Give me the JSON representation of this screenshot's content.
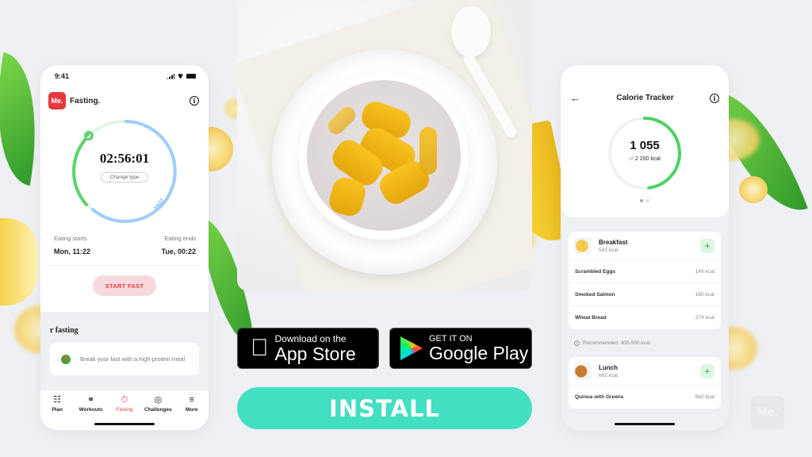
{
  "left_phone": {
    "status_time": "9:41",
    "logo_text": "Me.",
    "app_name": "Fasting.",
    "timer": "02:56:01",
    "change_type_label": "Change type",
    "ring_label": "FAST",
    "fast_progress": 0.4,
    "eating_starts_label": "Eating starts",
    "eating_starts_value": "Mon, 11:22",
    "eating_ends_label": "Eating ends",
    "eating_ends_value": "Tue, 00:22",
    "start_fast_label": "START FAST",
    "section_title": "r fasting",
    "tip_text": "Break your fast with a high-protein meal",
    "tabs": [
      {
        "label": "Plan",
        "icon": "plan-icon",
        "glyph": "☷"
      },
      {
        "label": "Workouts",
        "icon": "dumbbell-icon",
        "glyph": "⚭"
      },
      {
        "label": "Fasting",
        "icon": "stopwatch-icon",
        "glyph": "⏱",
        "active": true
      },
      {
        "label": "Challenges",
        "icon": "target-icon",
        "glyph": "◎"
      },
      {
        "label": "More",
        "icon": "menu-icon",
        "glyph": "≡"
      }
    ]
  },
  "right_phone": {
    "title": "Calorie Tracker",
    "calories_consumed": "1 055",
    "calories_of": "of",
    "calories_goal": "2 200 kcal",
    "progress": 0.48,
    "meals": [
      {
        "name": "Breakfast",
        "kcal": "583 kcal",
        "items": [
          {
            "name": "Scrambled Eggs",
            "kcal": "149 kcal"
          },
          {
            "name": "Smoked Salmon",
            "kcal": "160 kcal"
          },
          {
            "name": "Wheat Bread",
            "kcal": "274 kcal"
          }
        ]
      },
      {
        "name": "Lunch",
        "kcal": "662 kcal",
        "items": [
          {
            "name": "Quinoa with Greens",
            "kcal": "662 kcal"
          }
        ]
      }
    ],
    "recommendation": "Recommended: 400-500 kcal"
  },
  "center": {
    "app_store_small": "Download on the",
    "app_store_big": "App Store",
    "google_play_small": "GET IT ON",
    "google_play_big": "Google Play",
    "install_label": "INSTALL"
  },
  "watermark": "Me.",
  "colors": {
    "brand_red": "#e5393c",
    "install_teal": "#43dfc2",
    "ring_green": "#5ed36c",
    "ring_blue": "#9fcdfb"
  }
}
